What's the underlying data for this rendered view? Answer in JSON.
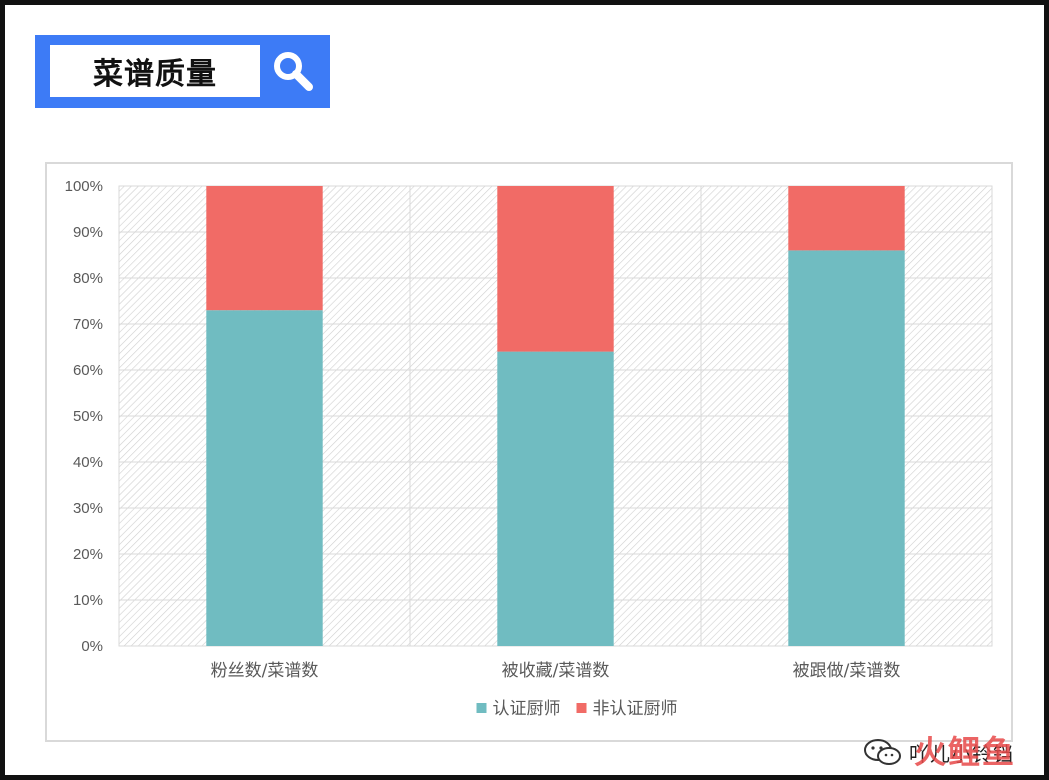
{
  "header": {
    "title": "菜谱质量",
    "search_icon": "search-icon"
  },
  "watermark": {
    "text": "吖儿小铃铛",
    "icon": "wechat-icon",
    "logo": "火鲤鱼"
  },
  "colors": {
    "banner": "#3d7bf6",
    "series_certified": "#70bcc1",
    "series_noncertified": "#f16b66"
  },
  "chart_data": {
    "type": "bar",
    "stacked": true,
    "categories": [
      "粉丝数/菜谱数",
      "被收藏/菜谱数",
      "被跟做/菜谱数"
    ],
    "series": [
      {
        "name": "认证厨师",
        "values": [
          73,
          64,
          86
        ]
      },
      {
        "name": "非认证厨师",
        "values": [
          27,
          36,
          14
        ]
      }
    ],
    "yticks": [
      "0%",
      "10%",
      "20%",
      "30%",
      "40%",
      "50%",
      "60%",
      "70%",
      "80%",
      "90%",
      "100%"
    ],
    "ylim": [
      0,
      100
    ],
    "grid": true,
    "legend": "bottom-center"
  }
}
